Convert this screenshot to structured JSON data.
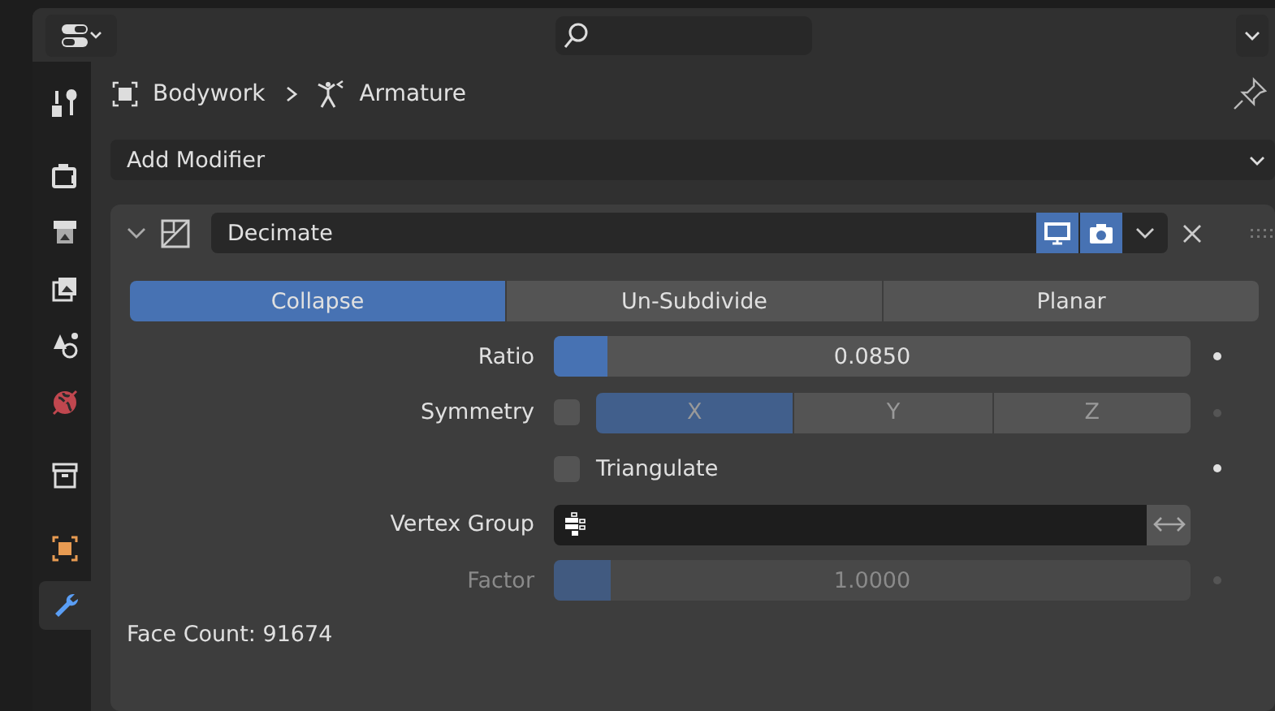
{
  "sidebar": {
    "items": [
      {
        "selected": false
      },
      {
        "selected": false
      },
      {
        "selected": false
      },
      {
        "selected": false
      },
      {
        "selected": false
      },
      {
        "selected": false
      },
      {
        "selected": false
      },
      {
        "selected": false
      },
      {
        "selected": true
      }
    ]
  },
  "breadcrumb": [
    {
      "label": "Bodywork"
    },
    {
      "label": "Armature"
    }
  ],
  "add_modifier": {
    "label": "Add Modifier"
  },
  "modifier": {
    "name": "Decimate",
    "expanded": true,
    "show_viewport": true,
    "show_render": true,
    "modes": [
      {
        "label": "Collapse",
        "selected": true
      },
      {
        "label": "Un-Subdivide",
        "selected": false
      },
      {
        "label": "Planar",
        "selected": false
      }
    ],
    "ratio": {
      "label": "Ratio",
      "reading": "0.0850",
      "level": 0.085
    },
    "symmetry": {
      "label": "Symmetry",
      "checked": false,
      "axes": [
        {
          "label": "X",
          "selected": true
        },
        {
          "label": "Y",
          "selected": false
        },
        {
          "label": "Z",
          "selected": false
        }
      ]
    },
    "triangulate": {
      "label": "Triangulate",
      "checked": false
    },
    "vertex_group": {
      "label": "Vertex Group"
    },
    "factor": {
      "label": "Factor",
      "reading": "1.0000",
      "level": 0.09,
      "disabled": true
    },
    "face_count": "Face Count: 91674"
  }
}
